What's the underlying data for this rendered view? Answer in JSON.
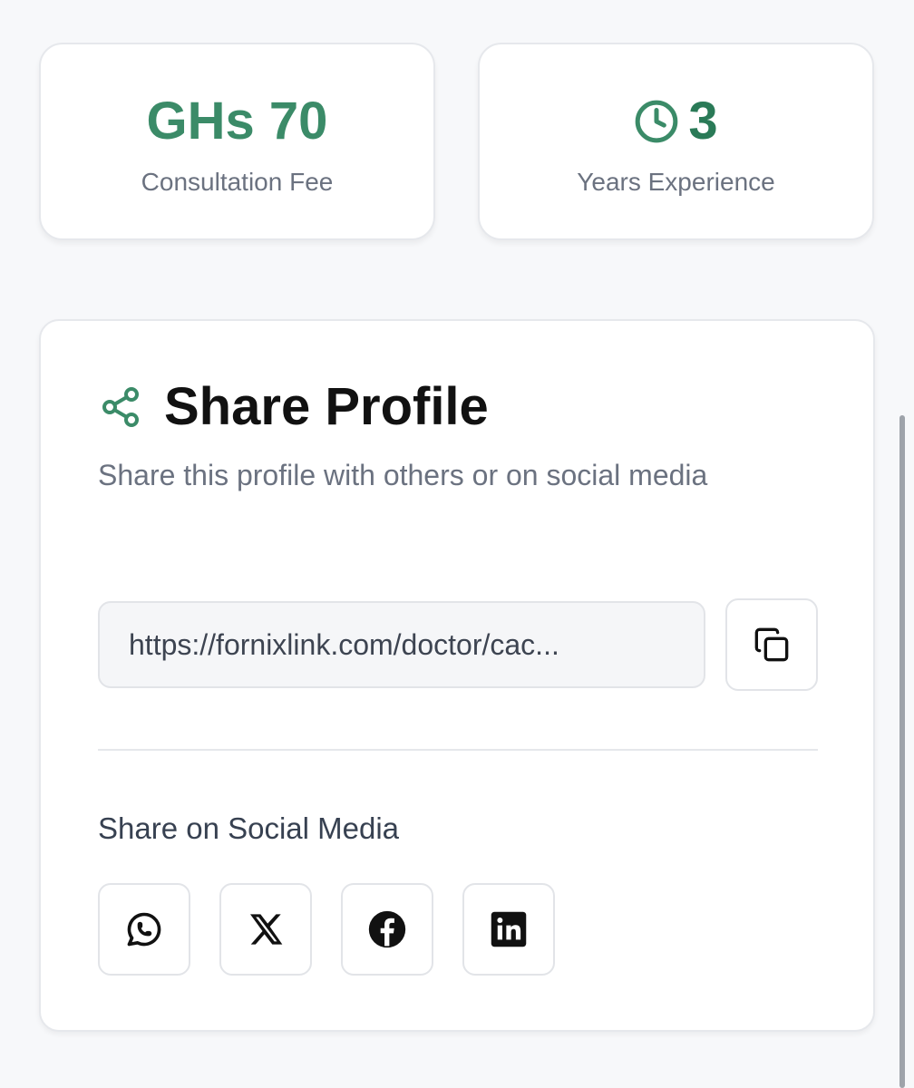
{
  "stats": {
    "fee": {
      "value": "GHs 70",
      "label": "Consultation Fee"
    },
    "experience": {
      "value": "3",
      "label": "Years Experience",
      "icon": "clock-icon"
    }
  },
  "share": {
    "title": "Share Profile",
    "description": "Share this profile with others or on social media",
    "url": "https://fornixlink.com/doctor/cac...",
    "copy_icon": "copy-icon",
    "social_title": "Share on Social Media",
    "social": [
      {
        "name": "whatsapp",
        "icon": "whatsapp-icon"
      },
      {
        "name": "x",
        "icon": "x-icon"
      },
      {
        "name": "facebook",
        "icon": "facebook-icon"
      },
      {
        "name": "linkedin",
        "icon": "linkedin-icon"
      }
    ]
  },
  "colors": {
    "accent": "#3b8b68",
    "background": "#f7f8fa"
  }
}
